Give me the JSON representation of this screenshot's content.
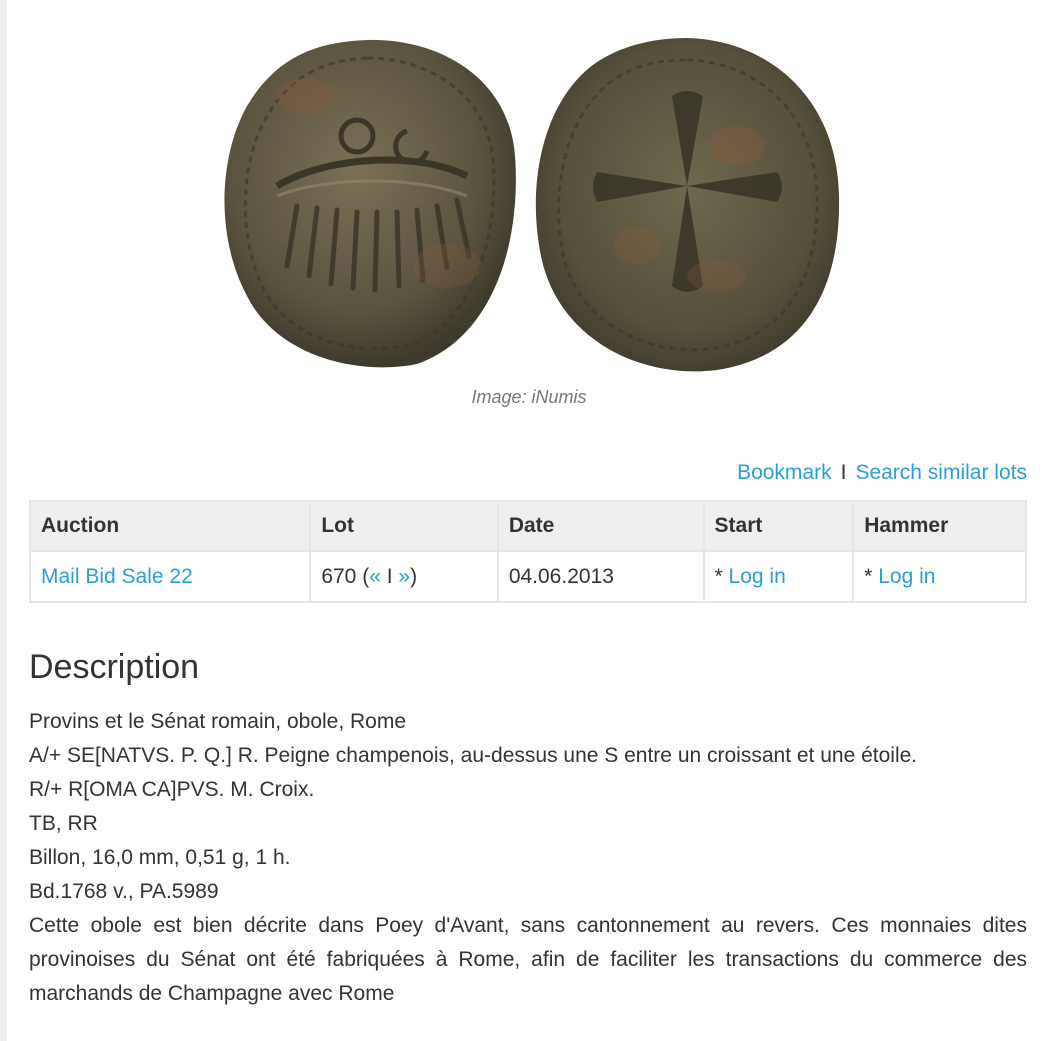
{
  "image": {
    "caption": "Image: iNumis",
    "obverse_alt": "coin-obverse",
    "reverse_alt": "coin-reverse",
    "colors": {
      "coin_dark": "#4a4536",
      "coin_mid": "#6e6648",
      "coin_light": "#8a7d5c",
      "rust": "#8a5a3c"
    }
  },
  "actions": {
    "bookmark": "Bookmark",
    "separator": "I",
    "search_similar": "Search similar lots"
  },
  "table": {
    "headers": [
      "Auction",
      "Lot",
      "Date",
      "Start",
      "Hammer"
    ],
    "row": {
      "auction": "Mail Bid Sale 22",
      "lot_number": "670",
      "lot_open": " (",
      "prev": "«",
      "pipe": " I ",
      "next": "»",
      "lot_close": ")",
      "date": "04.06.2013",
      "start_prefix": "* ",
      "start_link": "Log in",
      "hammer_prefix": "* ",
      "hammer_link": "Log in"
    }
  },
  "description": {
    "title": "Description",
    "lines": [
      "Provins et le Sénat romain, obole, Rome",
      "A/+ SE[NATVS. P. Q.] R. Peigne champenois, au-dessus une S entre un croissant et une étoile.",
      "R/+ R[OMA CA]PVS. M. Croix.",
      "TB, RR",
      "Billon, 16,0 mm, 0,51 g, 1 h.",
      "Bd.1768 v., PA.5989"
    ],
    "paragraph": "Cette obole est bien décrite dans Poey d'Avant, sans cantonnement au revers. Ces monnaies dites provinoises du Sénat ont été fabriquées à Rome, afin de faciliter les transactions du commerce des marchands de Champagne avec Rome"
  }
}
